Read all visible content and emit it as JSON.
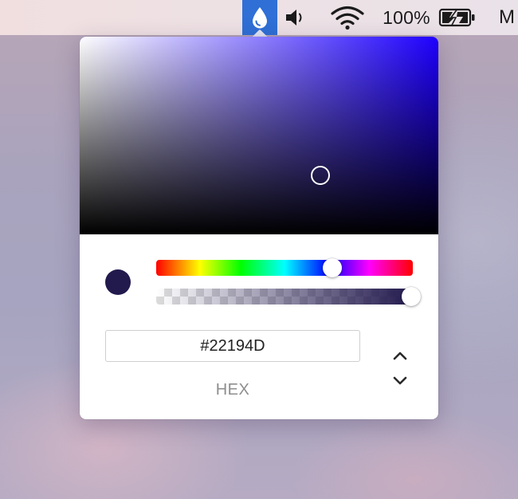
{
  "menubar": {
    "battery_percent": "100%",
    "user_initial": "M",
    "icons": {
      "app": "droplet-icon",
      "volume": "speaker-icon",
      "wifi": "wifi-icon",
      "battery": "battery-charging-icon"
    },
    "app_highlight_color": "#2F6FD6"
  },
  "picker": {
    "hue_color": "#1E00FF",
    "selected_color": "#22194D",
    "hue_fraction": 0.69,
    "alpha_fraction": 1.0,
    "saturation_fraction": 0.67,
    "brightness_fraction": 0.3,
    "hex_value": "#22194D",
    "format_label": "HEX"
  }
}
